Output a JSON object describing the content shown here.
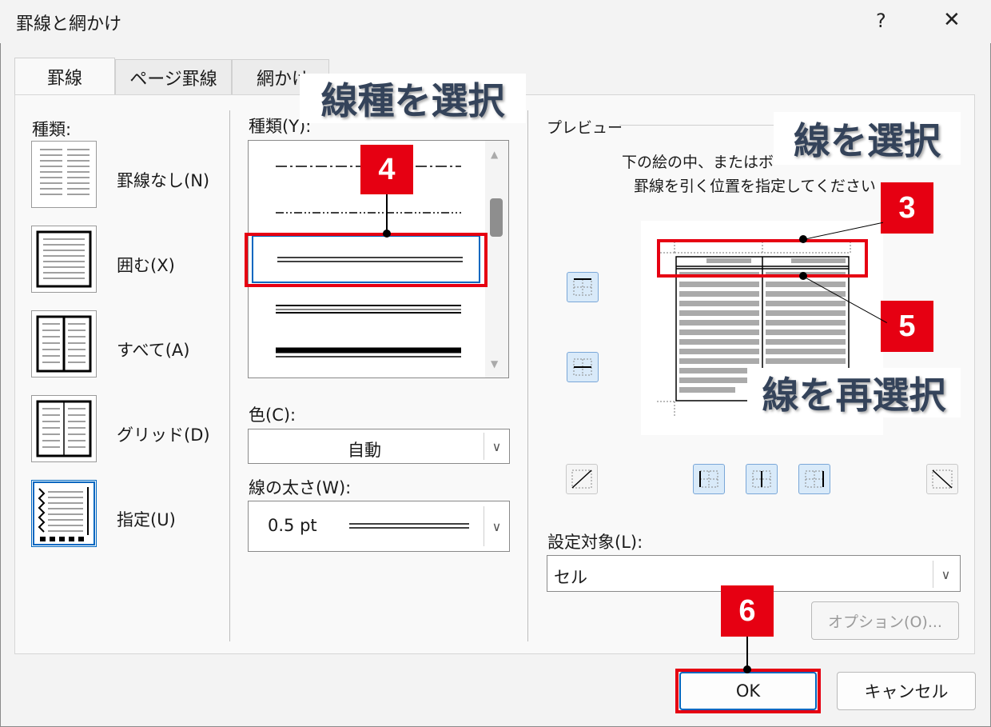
{
  "window": {
    "title": "罫線と網かけ",
    "help": "?",
    "close": "✕"
  },
  "tabs": [
    "罫線",
    "ページ罫線",
    "網かけ"
  ],
  "setting": {
    "label": "種類:",
    "items": [
      "罫線なし(N)",
      "囲む(X)",
      "すべて(A)",
      "グリッド(D)",
      "指定(U)"
    ]
  },
  "style": {
    "label": "種類(Y):",
    "color_label": "色(C):",
    "color_value": "自動",
    "width_label": "線の太さ(W):",
    "width_value": "0.5 pt"
  },
  "preview": {
    "label": "プレビュー",
    "instruction_line1": "下の絵の中、またはボ",
    "instruction_line2": "罫線を引く位置を指定してください"
  },
  "apply": {
    "label": "設定対象(L):",
    "value": "セル",
    "options_button": "オプション(O)..."
  },
  "buttons": {
    "ok": "OK",
    "cancel": "キャンセル"
  },
  "annotations": {
    "callout_linestyle": "線種を選択",
    "callout_line": "線を選択",
    "callout_reselect": "線を再選択",
    "badge3": "3",
    "badge4": "4",
    "badge5": "5",
    "badge6": "6"
  },
  "colors": {
    "highlight": "#e60012",
    "selection": "#0067c0"
  }
}
